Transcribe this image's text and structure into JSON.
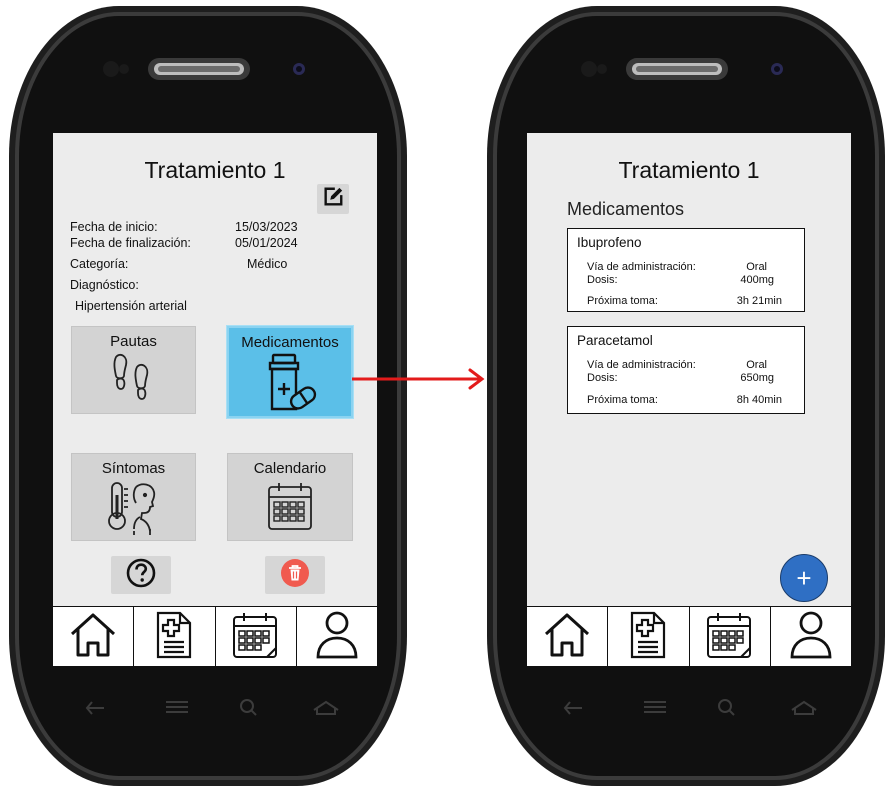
{
  "screen1": {
    "title": "Tratamiento 1",
    "info": {
      "start_label": "Fecha de inicio:",
      "start_value": "15/03/2023",
      "end_label": "Fecha de finalización:",
      "end_value": "05/01/2024",
      "category_label": "Categoría:",
      "category_value": "Médico",
      "diagnosis_label": "Diagnóstico:",
      "diagnosis_value": "Hipertensión arterial"
    },
    "tiles": {
      "pautas": "Pautas",
      "medicamentos": "Medicamentos",
      "sintomas": "Síntomas",
      "calendario": "Calendario"
    },
    "icons": [
      "edit-icon",
      "footprints-icon",
      "medicine-icon",
      "thermometer-icon",
      "calendar-icon",
      "help-icon",
      "trash-icon"
    ]
  },
  "screen2": {
    "title": "Tratamiento 1",
    "section": "Medicamentos",
    "medications": [
      {
        "name": "Ibuprofeno",
        "route_label": "Vía de administración:",
        "route": "Oral",
        "dose_label": "Dosis:",
        "dose": "400mg",
        "next_label": "Próxima toma:",
        "next": "3h 21min"
      },
      {
        "name": "Paracetamol",
        "route_label": "Vía de administración:",
        "route": "Oral",
        "dose_label": "Dosis:",
        "dose": "650mg",
        "next_label": "Próxima toma:",
        "next": "8h 40min"
      }
    ],
    "fab_label": "+"
  },
  "navbar": {
    "items": [
      "home-icon",
      "document-icon",
      "calendar-icon",
      "user-icon"
    ]
  },
  "colors": {
    "accent": "#5bbfe8",
    "fab": "#2f6fc4",
    "arrow": "#e31b1b",
    "delete": "#f05a4f"
  }
}
